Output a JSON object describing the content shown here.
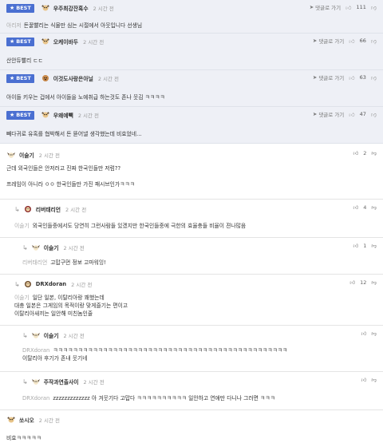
{
  "best_label": "BEST",
  "reply_link": "댓글로 가기",
  "best": [
    {
      "nick": "우주최강잔혹수",
      "time": "2 시간 전",
      "likes": "111",
      "mention": "아리저",
      "text": "돈꿀빨리는 식물만 심는 시절에서 아웃입니다 선생님"
    },
    {
      "nick": "오케이바두",
      "time": "2 시간 전",
      "likes": "66",
      "mention": "",
      "text": "산안듀빨리 ㄷㄷ"
    },
    {
      "nick": "이것도사랑은아닐",
      "time": "2 시간 전",
      "likes": "63",
      "mention": "",
      "text": "아이들 키우는 겁에서 아이들을 노예취급 하는것도 존나 웃김 ㅋㅋㅋㅋ"
    },
    {
      "nick": "우왜예빽",
      "time": "2 시간 전",
      "likes": "47",
      "mention": "",
      "text": "빼다귀로 유혹를 협박해서 돈 뜯어낼 생각했는데 비효었네..."
    }
  ],
  "comments": [
    {
      "nick": "이술기",
      "time": "2 시간 전",
      "likes": "2",
      "mention": "",
      "lines": [
        "근데 외국인들은 안저러고 진짜 한국인들만 저럼??",
        "",
        "프레임이 아니라 ㅇㅇ 한국인들만 가진 패시브인가ㅋㅋㅋ"
      ]
    },
    {
      "nick": "리버태리언",
      "time": "2 시간 전",
      "likes": "4",
      "mention": "이술기",
      "lines": [
        "외국인들중에서도 당연히 그런사람들 있겠지만 한국인들중에 극한의 효율충들 비율이 젼나많음"
      ]
    },
    {
      "nick": "이술기",
      "time": "2 시간 전",
      "likes": "1",
      "mention": "리버태리언",
      "lines": [
        "고맙구먼 정보 고마워잉!"
      ]
    },
    {
      "nick": "DRXdoran",
      "time": "2 시간 전",
      "likes": "12",
      "mention": "이술기",
      "lines": [
        "일단 일본, 이탈리아랑 꽤했는데",
        "대충 일본은 그게임의 목적이랑 맞게즐기는 편이고",
        "이탈리아새끼는 일안해 미친놈인줄"
      ]
    },
    {
      "nick": "이술기",
      "time": "2 시간 전",
      "likes": "",
      "mention": "DRXdoran",
      "lines": [
        "ㅋㅋㅋㅋㅋㅋㅋㅋㅋㅋㅋㅋㅋㅋㅋㅋㅋㅋㅋㅋㅋㅋㅋㅋㅋㅋㅋㅋㅋㅋㅋㅋㅋㅋㅋㅋㅋㅋㅋㅋㅋㅋㅋㅋㅋㅋㅋ",
        "이탈리아 후기가 존내 웃기네"
      ]
    },
    {
      "nick": "주작과연출사이",
      "time": "2 시간 전",
      "likes": "",
      "mention": "DRXdoran",
      "lines": [
        "zzzzzzzzzzzzz 아 겨웃기다 고맙다 ㅋㅋㅋㅋㅋㅋㅋㅋㅋㅋ 일안하고 연애만 다니나 그러면 ㅋㅋㅋ"
      ]
    },
    {
      "nick": "쏘시오",
      "time": "2 시간 전",
      "likes": "",
      "mention": "",
      "lines": [
        "비효ㅋㅋㅋㅋㅋ"
      ]
    }
  ]
}
